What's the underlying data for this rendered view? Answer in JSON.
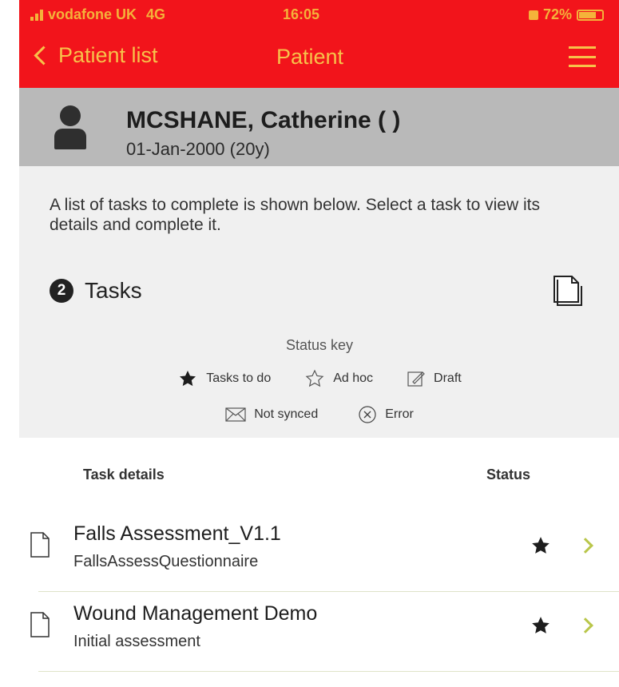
{
  "status_bar": {
    "carrier": "vodafone UK",
    "network": "4G",
    "time": "16:05",
    "battery": "72%"
  },
  "nav": {
    "back_label": "Patient list",
    "title": "Patient"
  },
  "patient": {
    "name": "MCSHANE, Catherine ( )",
    "dob": "01-Jan-2000 (20y)"
  },
  "intro_text": "A list of tasks to complete is shown below. Select a task to view its details and complete it.",
  "tasks": {
    "count": "2",
    "label": "Tasks"
  },
  "status_key": {
    "title": "Status key",
    "items": [
      {
        "icon": "star-filled-icon",
        "label": "Tasks to do"
      },
      {
        "icon": "star-outline-icon",
        "label": "Ad hoc"
      },
      {
        "icon": "edit-draft-icon",
        "label": "Draft"
      },
      {
        "icon": "envelope-icon",
        "label": "Not synced"
      },
      {
        "icon": "error-x-icon",
        "label": "Error"
      }
    ]
  },
  "table": {
    "col_details": "Task details",
    "col_status": "Status",
    "rows": [
      {
        "title": "Falls Assessment_V1.1",
        "subtitle": "FallsAssessQuestionnaire",
        "status_icon": "star-filled-icon"
      },
      {
        "title": "Wound Management Demo",
        "subtitle": "Initial assessment",
        "status_icon": "star-filled-icon"
      }
    ]
  },
  "colors": {
    "header_red": "#f2141b",
    "nav_text": "#f7c14a",
    "patient_band": "#b9b9b9",
    "panel_bg": "#f0f0f0",
    "chevron": "#b9c64a"
  }
}
